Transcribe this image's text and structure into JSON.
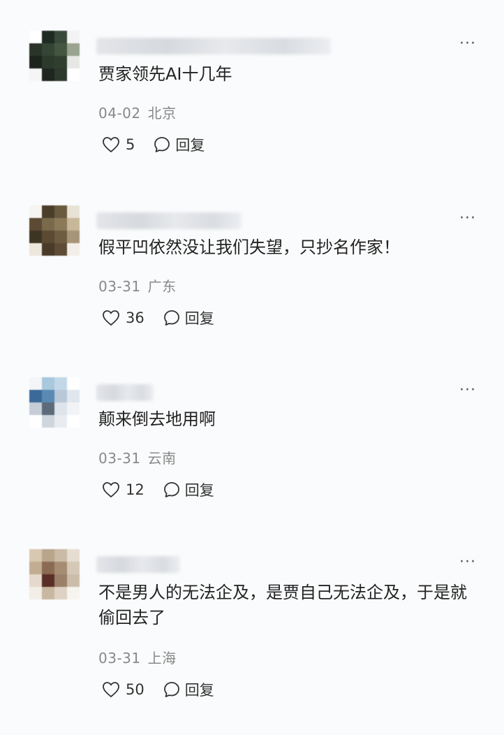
{
  "more_label": "···",
  "comments": [
    {
      "text": "贾家领先AI十几年",
      "date": "04-02",
      "location": "北京",
      "likes": "5",
      "reply_label": "回复",
      "avatar_colors": [
        "#ffffff",
        "#1f2b22",
        "#3a4a3a",
        "#f3f3f3",
        "#2a3428",
        "#354535",
        "#44563f",
        "#9aa38f",
        "#1c231c",
        "#2c3a2c",
        "#303e2e",
        "#e7e8e5",
        "#f5f5f5",
        "#1e261f",
        "#2d3a2b",
        "#ffffff"
      ]
    },
    {
      "text": "假平凹依然没让我们失望，只抄名作家！",
      "date": "03-31",
      "location": "广东",
      "likes": "36",
      "reply_label": "回复",
      "avatar_colors": [
        "#f6f5f2",
        "#4a3e2b",
        "#6a5a3e",
        "#e8e2d5",
        "#5c4a34",
        "#7a6a4c",
        "#8a7a58",
        "#c8b89a",
        "#3e3424",
        "#5a4a32",
        "#6e5c40",
        "#a89476",
        "#ece6dc",
        "#4a3a2a",
        "#5e4c36",
        "#f3efe8"
      ]
    },
    {
      "text": "颠来倒去地用啊",
      "date": "03-31",
      "location": "云南",
      "likes": "12",
      "reply_label": "回复",
      "avatar_colors": [
        "#f3f5f8",
        "#a8c8de",
        "#c2d8e8",
        "#ffffff",
        "#3c6a98",
        "#5a8ab4",
        "#b8c8d8",
        "#e0e6ee",
        "#c7cdd6",
        "#5c6a7a",
        "#dfe4ea",
        "#f1f3f6",
        "#ffffff",
        "#cfd5dd",
        "#e8ecf1",
        "#ffffff"
      ]
    },
    {
      "text": "不是男人的无法企及，是贾自己无法企及，于是就偷回去了",
      "date": "03-31",
      "location": "上海",
      "likes": "50",
      "reply_label": "回复",
      "avatar_colors": [
        "#d8c8b2",
        "#b8a58a",
        "#c9bba5",
        "#e6ddd0",
        "#c2ad92",
        "#8a6a52",
        "#a68c72",
        "#d6c8b6",
        "#e4d9cc",
        "#5a2e26",
        "#9a8068",
        "#cbbda9",
        "#f2ede6",
        "#c8b8a2",
        "#ddd2c3",
        "#f7f4ef"
      ]
    }
  ]
}
